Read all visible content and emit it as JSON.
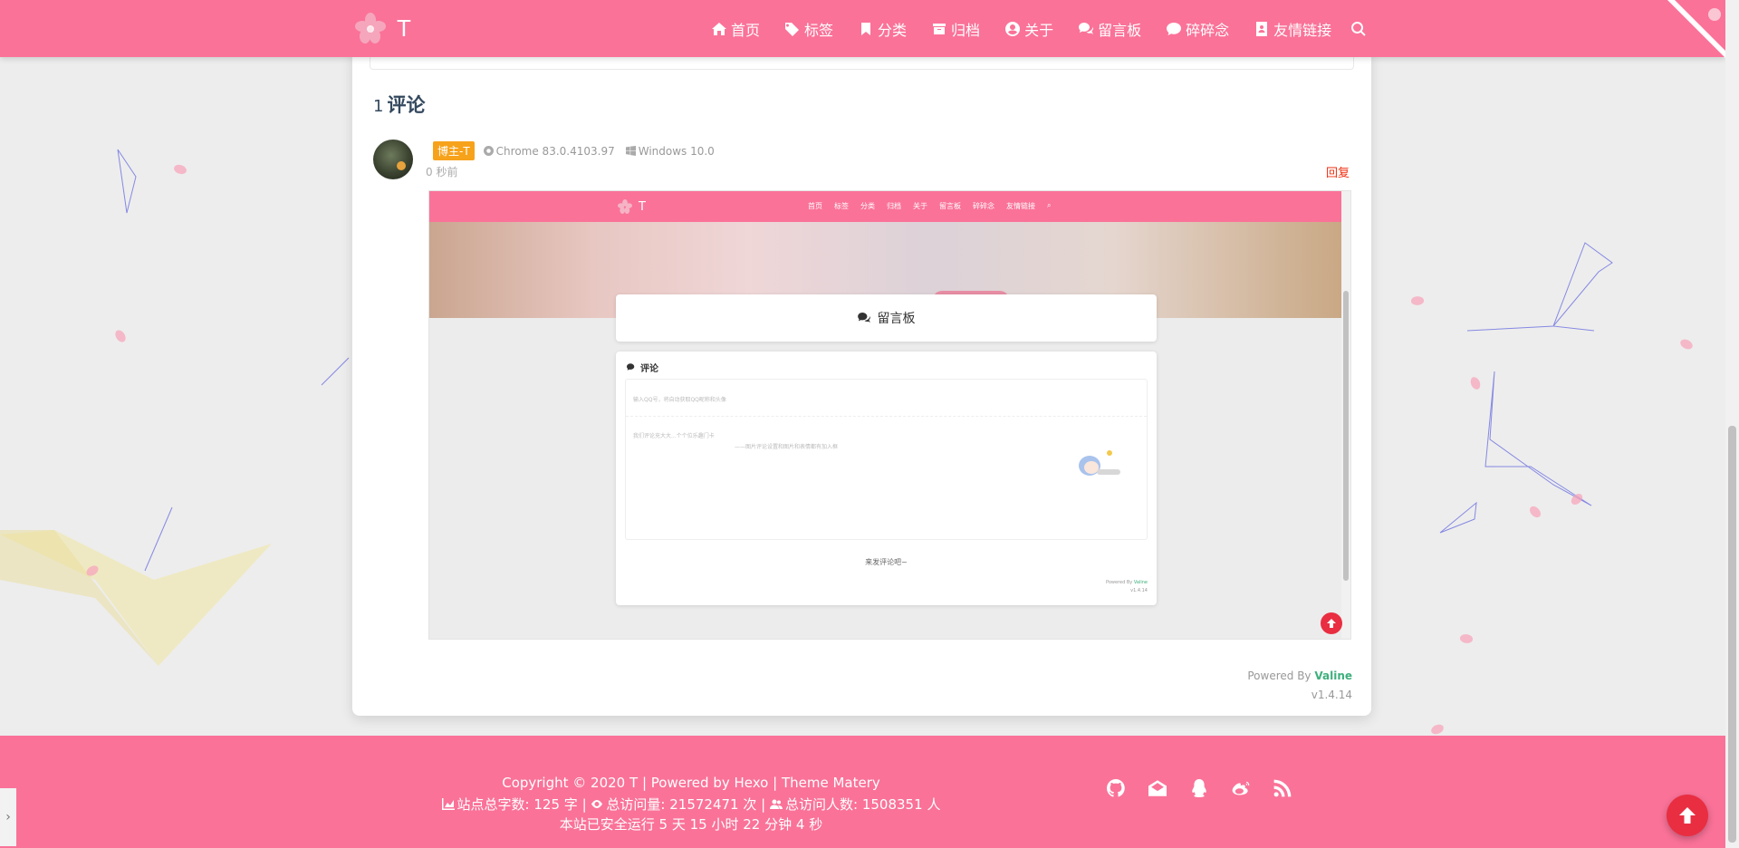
{
  "colors": {
    "primary": "#fa7298",
    "link_green": "#3eaf7c",
    "reply_red": "#ef2f11",
    "badge": "#f7a21b",
    "to_top": "#e92e42"
  },
  "header": {
    "logo_icon": "sakura-icon",
    "brand": "T",
    "nav": [
      {
        "label": "首页",
        "icon": "home-icon"
      },
      {
        "label": "标签",
        "icon": "tags-icon"
      },
      {
        "label": "分类",
        "icon": "bookmark-icon"
      },
      {
        "label": "归档",
        "icon": "archive-icon"
      },
      {
        "label": "关于",
        "icon": "user-circle-icon"
      },
      {
        "label": "留言板",
        "icon": "comments-icon"
      },
      {
        "label": "碎碎念",
        "icon": "comment-icon"
      },
      {
        "label": "友情链接",
        "icon": "address-book-icon"
      }
    ],
    "search_icon": "search-icon"
  },
  "comments": {
    "count": "1",
    "title": "评论",
    "item": {
      "badge": "博主-T",
      "browser": "Chrome 83.0.4103.97",
      "os": "Windows 10.0",
      "time": "0 秒前",
      "reply": "回复"
    },
    "powered_prefix": "Powered By",
    "powered_name": "Valine",
    "version": "v1.4.14"
  },
  "embedded": {
    "brand": "T",
    "nav": [
      "首页",
      "标签",
      "分类",
      "归档",
      "关于",
      "留言板",
      "碎碎念",
      "友情链接"
    ],
    "board_title": "留言板",
    "comment_title": "评论",
    "placeholder_nick": "输入QQ号，将自动获取QQ昵称和头像",
    "placeholder_text": "我们评论充大大...个个位乐趣门卡",
    "placeholder_hint": "——图片评论设置和图片和表情都有加入框",
    "empty": "来发评论吧~",
    "powered_prefix": "Powered By",
    "powered_name": "Valine",
    "version": "v1.4.14"
  },
  "footer": {
    "copyright_prefix": "Copyright © 2020",
    "site": "T",
    "powered_by": "Powered by",
    "hexo": "Hexo",
    "theme_prefix": "Theme",
    "theme": "Matery",
    "words_label": "站点总字数:",
    "words": "125",
    "words_unit": "字",
    "pv_label": "总访问量:",
    "pv": "21572471",
    "pv_unit": "次",
    "uv_label": "总访问人数:",
    "uv": "1508351",
    "uv_unit": "人",
    "runtime": "本站已安全运行 5 天 15 小时 22 分钟 4 秒",
    "social": [
      "github-icon",
      "email-icon",
      "qq-icon",
      "weibo-icon",
      "rss-icon"
    ]
  }
}
